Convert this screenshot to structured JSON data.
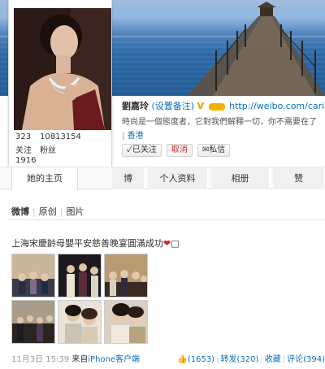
{
  "profile": {
    "name": "劉嘉玲",
    "remark_link": "(设置备注)",
    "verified_badge": "V",
    "url": "http://weibo.com/carin",
    "bio": "時尚是一個態度者，它對我們解釋一切，你不需要在了",
    "location_dash": "|",
    "location": "香港",
    "stats": {
      "following_count": "323",
      "followers_count": "10813154",
      "posts_count": "1916",
      "following_label": "关注",
      "followers_label": "粉丝"
    }
  },
  "actions": {
    "followed": "✓已关注",
    "unfollow": "取消",
    "message": "✉私信"
  },
  "tabs": [
    {
      "label": "她的主页"
    },
    {
      "label": "博"
    },
    {
      "label": "个人资料"
    },
    {
      "label": "相册"
    },
    {
      "label": "赞"
    }
  ],
  "filters": {
    "weibo": "微博",
    "original": "原创",
    "images": "图片"
  },
  "post": {
    "text": "上海宋慶齡母嬰平安慈善晚宴圓滿成功",
    "heart": "❤",
    "tail": "□",
    "time": "11月3日 15:39",
    "source_prefix": "来自",
    "client": "iPhone客户端",
    "likes": "(1653)",
    "reposts": "转发(320)",
    "favorite": "收藏",
    "comments": "评论(394)"
  },
  "colors": {
    "link": "#0a6fbd",
    "heart": "#d2222a",
    "sky": "#5a8cc4",
    "sea": "#215a95"
  }
}
